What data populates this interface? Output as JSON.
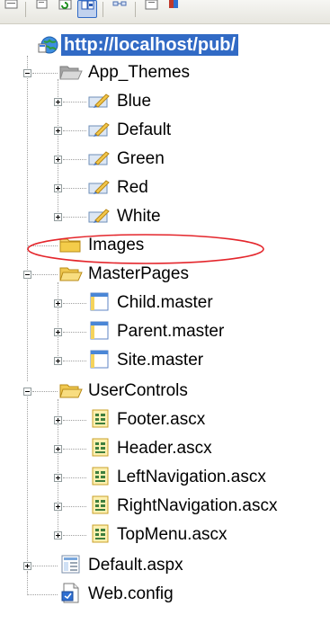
{
  "root": {
    "label": "http://localhost/pub/"
  },
  "nodes": [
    {
      "label": "App_Themes",
      "type": "folder-open",
      "state": "expanded"
    },
    {
      "label": "Blue",
      "type": "theme",
      "state": "collapsed"
    },
    {
      "label": "Default",
      "type": "theme",
      "state": "collapsed"
    },
    {
      "label": "Green",
      "type": "theme",
      "state": "collapsed"
    },
    {
      "label": "Red",
      "type": "theme",
      "state": "collapsed"
    },
    {
      "label": "White",
      "type": "theme",
      "state": "collapsed"
    },
    {
      "label": "Images",
      "type": "folder",
      "state": "none",
      "highlighted": true
    },
    {
      "label": "MasterPages",
      "type": "folder-open",
      "state": "expanded"
    },
    {
      "label": "Child.master",
      "type": "master",
      "state": "collapsed"
    },
    {
      "label": "Parent.master",
      "type": "master",
      "state": "collapsed"
    },
    {
      "label": "Site.master",
      "type": "master",
      "state": "collapsed"
    },
    {
      "label": "UserControls",
      "type": "folder-open",
      "state": "expanded"
    },
    {
      "label": "Footer.ascx",
      "type": "ascx",
      "state": "collapsed"
    },
    {
      "label": "Header.ascx",
      "type": "ascx",
      "state": "collapsed"
    },
    {
      "label": "LeftNavigation.ascx",
      "type": "ascx",
      "state": "collapsed"
    },
    {
      "label": "RightNavigation.ascx",
      "type": "ascx",
      "state": "collapsed"
    },
    {
      "label": "TopMenu.ascx",
      "type": "ascx",
      "state": "collapsed"
    },
    {
      "label": "Default.aspx",
      "type": "aspx",
      "state": "collapsed"
    },
    {
      "label": "Web.config",
      "type": "config",
      "state": "none"
    }
  ],
  "toolbar": {
    "buttons": [
      "properties-icon",
      "show-all-files-icon",
      "refresh-icon",
      "nest-related-files-icon",
      "view-class-diagram-icon",
      "view-code-icon",
      "view-designer-icon"
    ]
  },
  "colors": {
    "selection": "#316ac5",
    "highlight_ellipse": "#e4262c"
  }
}
